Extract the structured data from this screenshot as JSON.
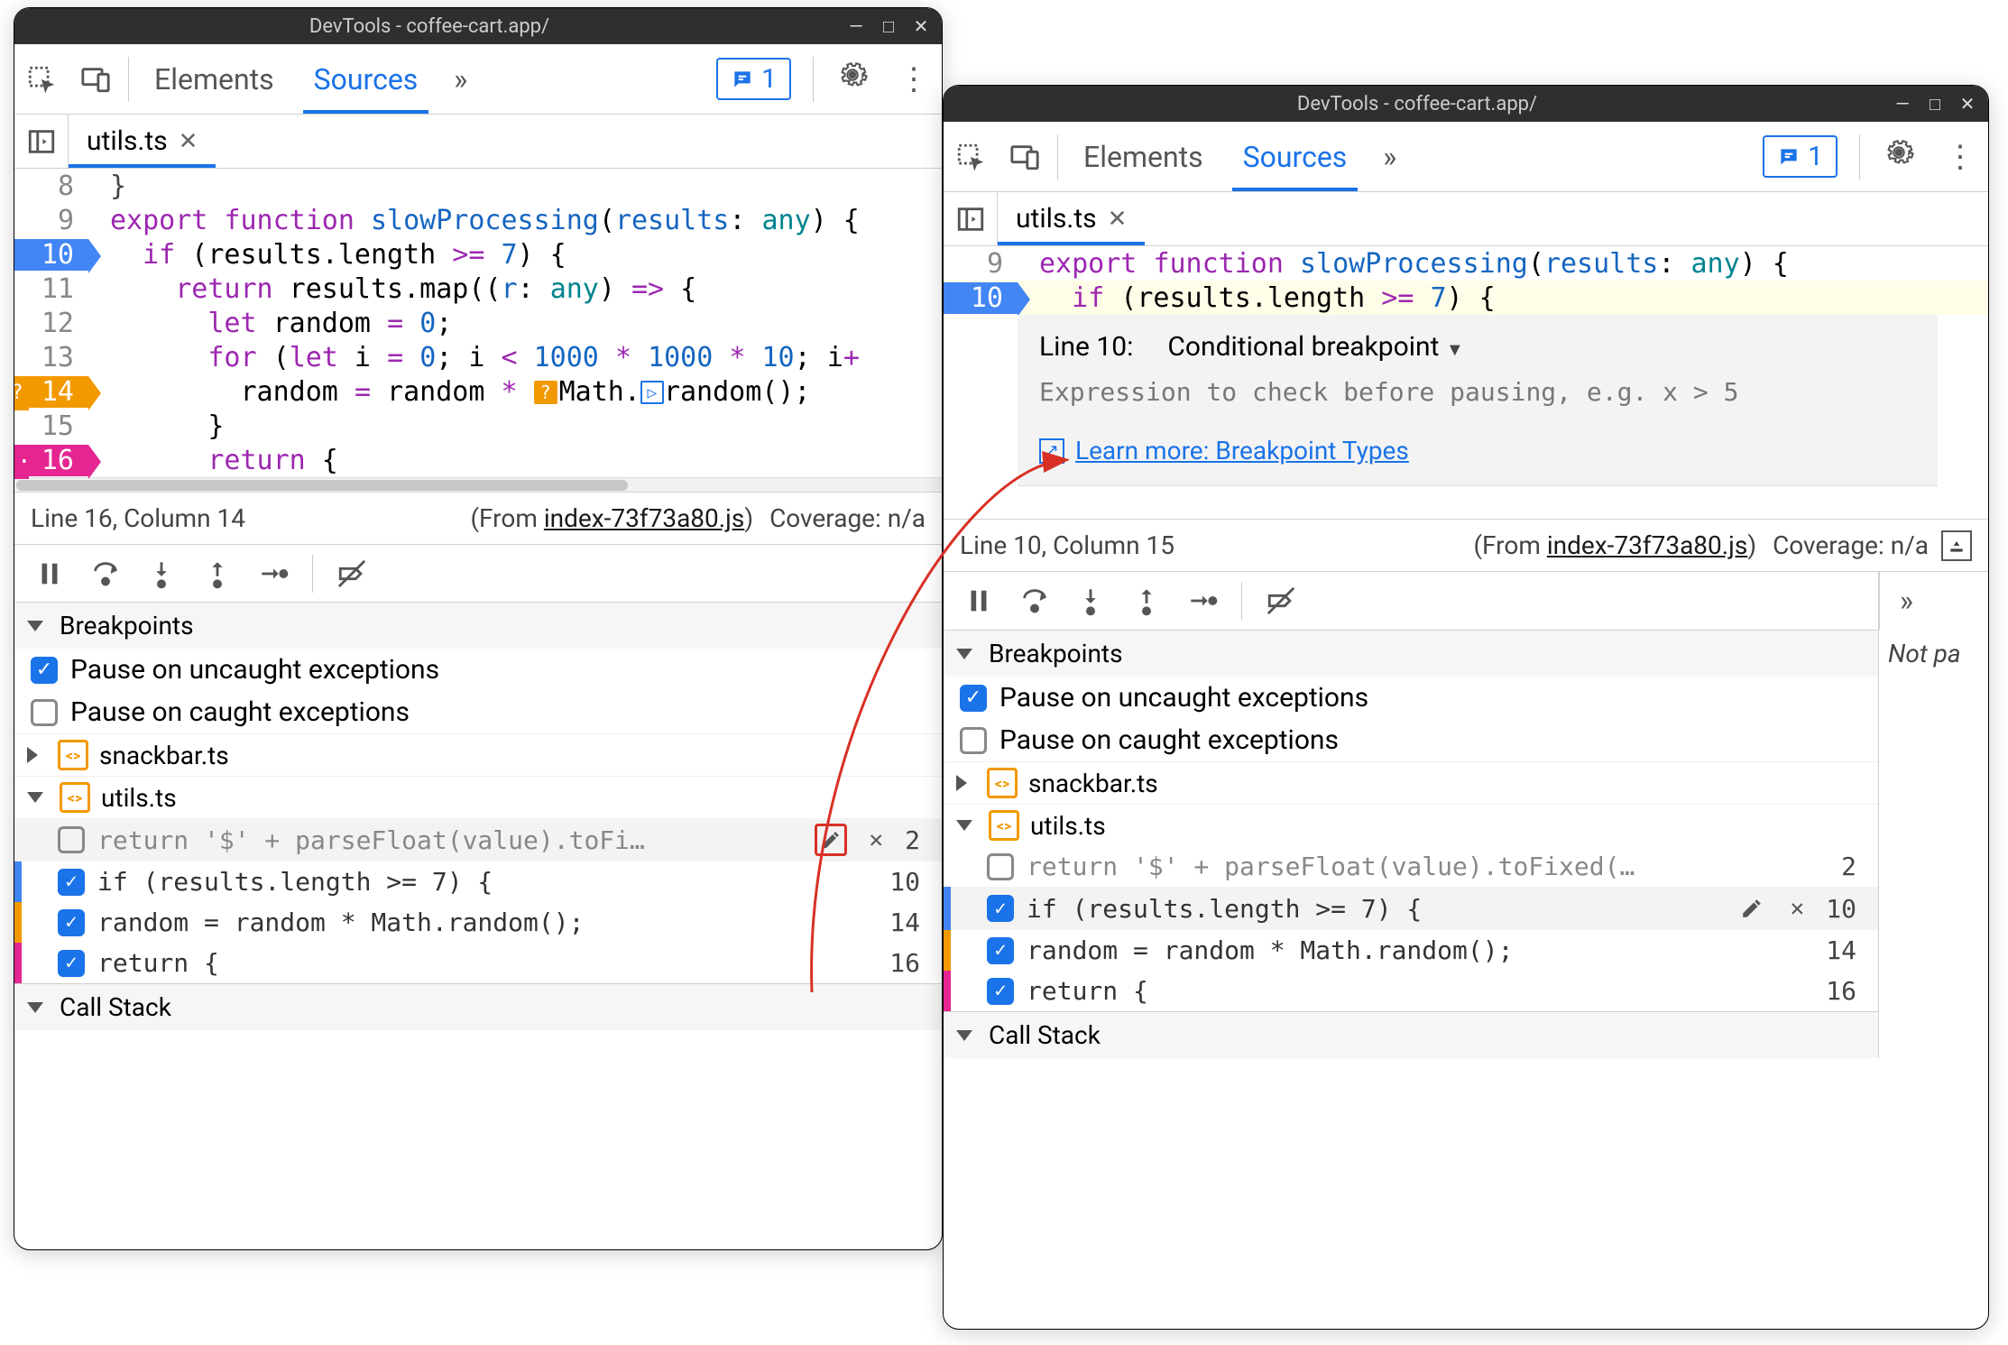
{
  "window": {
    "title": "DevTools - coffee-cart.app/"
  },
  "toolbar": {
    "tab_elements": "Elements",
    "tab_sources": "Sources",
    "issues_count": "1"
  },
  "file_tab": {
    "name": "utils.ts"
  },
  "left": {
    "code": {
      "l8": "",
      "l9": "export function slowProcessing(results: any) {",
      "l10": "  if (results.length >= 7) {",
      "l11": "    return results.map((r: any) => {",
      "l12": "      let random = 0;",
      "l13": "      for (let i = 0; i < 1000 * 1000 * 10; i+",
      "l14": "        random = random * Math.random();",
      "l15": "      }",
      "l16": "      return {",
      "gutters": [
        "8",
        "9",
        "10",
        "11",
        "12",
        "13",
        "14",
        "15",
        "16"
      ]
    },
    "status": {
      "pos": "Line 16, Column 14",
      "from_label": "From",
      "from_file": "index-73f73a80.js",
      "coverage": "Coverage: n/a"
    }
  },
  "right": {
    "code": {
      "l9": "export function slowProcessing(results: any) {",
      "l10": "  if (results.length >= 7) {",
      "gutters": [
        "9",
        "10"
      ]
    },
    "popup": {
      "line_label": "Line 10:",
      "type": "Conditional breakpoint",
      "placeholder": "Expression to check before pausing, e.g. x > 5",
      "learn": "Learn more: Breakpoint Types"
    },
    "status": {
      "pos": "Line 10, Column 15",
      "from_label": "From",
      "from_file": "index-73f73a80.js",
      "coverage": "Coverage: n/a"
    },
    "side_text": "Not pa"
  },
  "breakpoints": {
    "header": "Breakpoints",
    "pause_uncaught": "Pause on uncaught exceptions",
    "pause_caught": "Pause on caught exceptions",
    "files": {
      "snackbar": "snackbar.ts",
      "utils": "utils.ts"
    },
    "items": [
      {
        "code": "return '$' + parseFloat(value).toFi…",
        "line": "2",
        "checked": false
      },
      {
        "code": "if (results.length >= 7) {",
        "line": "10",
        "checked": true
      },
      {
        "code": "random = random * Math.random();",
        "line": "14",
        "checked": true
      },
      {
        "code": "return {",
        "line": "16",
        "checked": true
      }
    ],
    "items_right": [
      {
        "code": "return '$' + parseFloat(value).toFixed(…",
        "line": "2",
        "checked": false
      },
      {
        "code": "if (results.length >= 7) {",
        "line": "10",
        "checked": true
      },
      {
        "code": "random = random * Math.random();",
        "line": "14",
        "checked": true
      },
      {
        "code": "return {",
        "line": "16",
        "checked": true
      }
    ]
  },
  "callstack": {
    "header": "Call Stack"
  },
  "icons": {
    "inspect": "inspect-icon",
    "device": "device-icon",
    "chat": "chat-icon",
    "gear": "gear-icon",
    "vdots": "more-icon",
    "show_nav": "show-navigator-icon",
    "close": "close-icon",
    "pause": "pause-icon",
    "step_over": "step-over-icon",
    "step_into": "step-into-icon",
    "step_out": "step-out-icon",
    "step": "step-icon",
    "deactivate": "deactivate-breakpoints-icon",
    "edit": "edit-icon",
    "remove": "remove-icon",
    "expand": "expand-icon",
    "collapse": "collapse-icon",
    "external": "external-link-icon",
    "more_tabs": "more-tabs-icon",
    "coverage": "coverage-icon"
  }
}
